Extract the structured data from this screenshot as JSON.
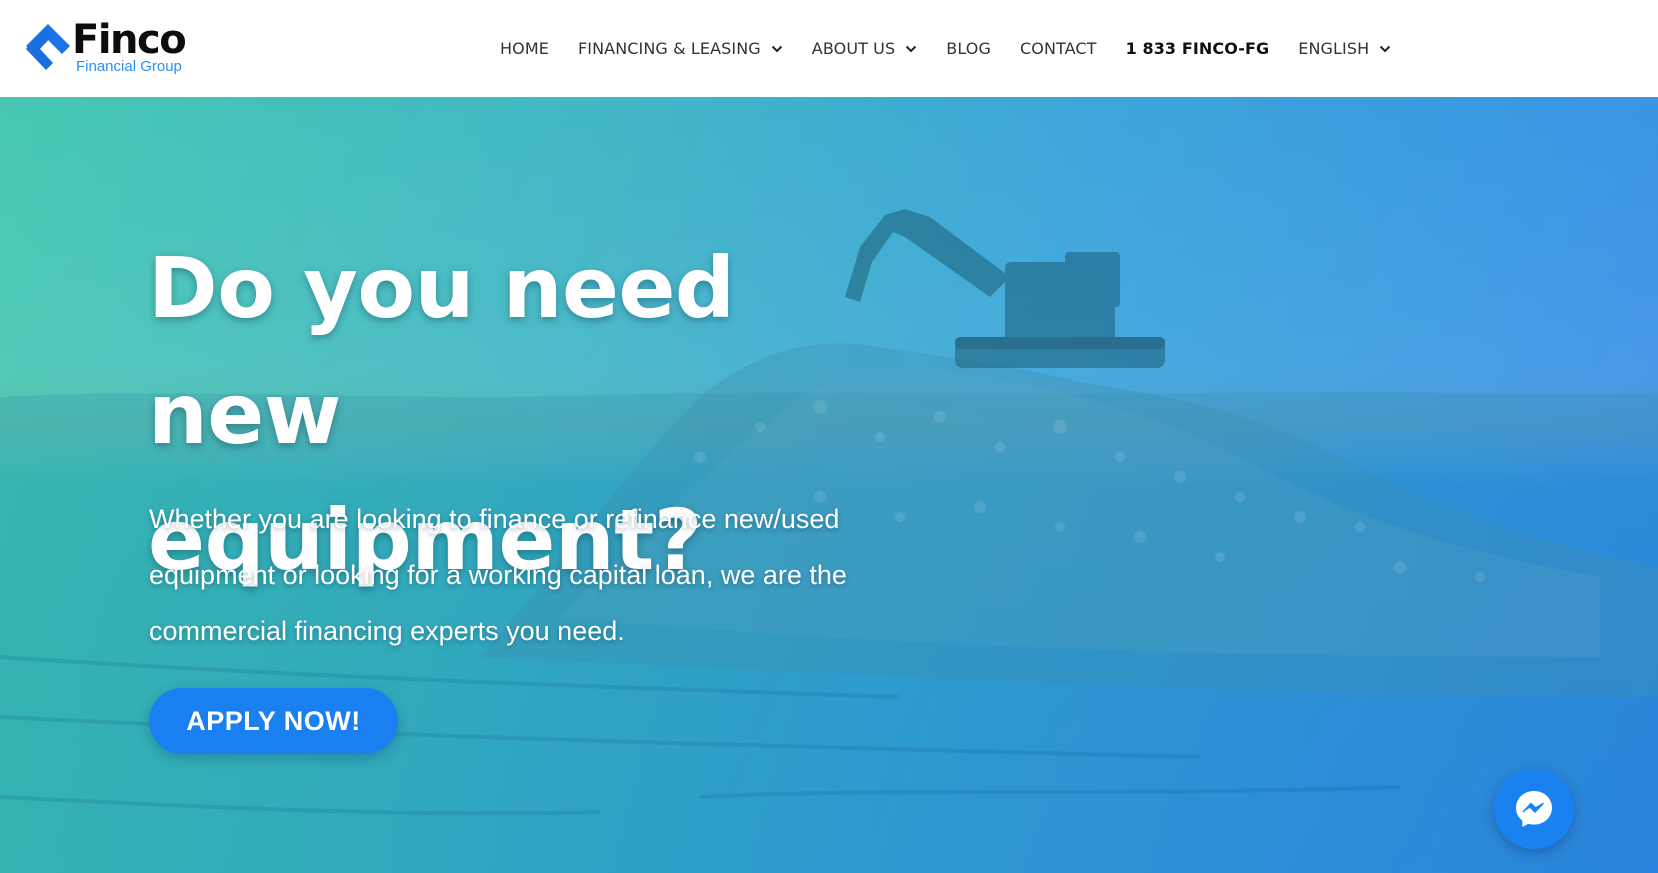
{
  "brand": {
    "name": "Finco",
    "tagline": "Financial Group",
    "colors": {
      "logo_blue": "#1a73e8",
      "tagline_blue": "#2e8ff0"
    }
  },
  "nav": {
    "items": [
      {
        "label": "HOME",
        "has_dropdown": false
      },
      {
        "label": "FINANCING & LEASING",
        "has_dropdown": true
      },
      {
        "label": "ABOUT US",
        "has_dropdown": true
      },
      {
        "label": "BLOG",
        "has_dropdown": false
      },
      {
        "label": "CONTACT",
        "has_dropdown": false
      },
      {
        "label": "1 833 FINCO-FG",
        "has_dropdown": false,
        "emphasis": "bold"
      },
      {
        "label": "ENGLISH",
        "has_dropdown": true
      }
    ],
    "icon": "chevron-down-icon"
  },
  "hero": {
    "title": "Do you need new equipment?",
    "subtitle": "Whether you are looking to finance or refinance new/used equipment or looking for a working capital loan, we are the commercial financing experts you need.",
    "cta_label": "APPLY NOW!",
    "colors": {
      "overlay_start": "#3bc4ad",
      "overlay_end": "#2d87e6",
      "cta": "#1a7ff0"
    },
    "background_icon": "excavator-on-gravel-mound"
  },
  "chat_widget": {
    "icon": "messenger-icon",
    "color": "#1a82f0"
  }
}
